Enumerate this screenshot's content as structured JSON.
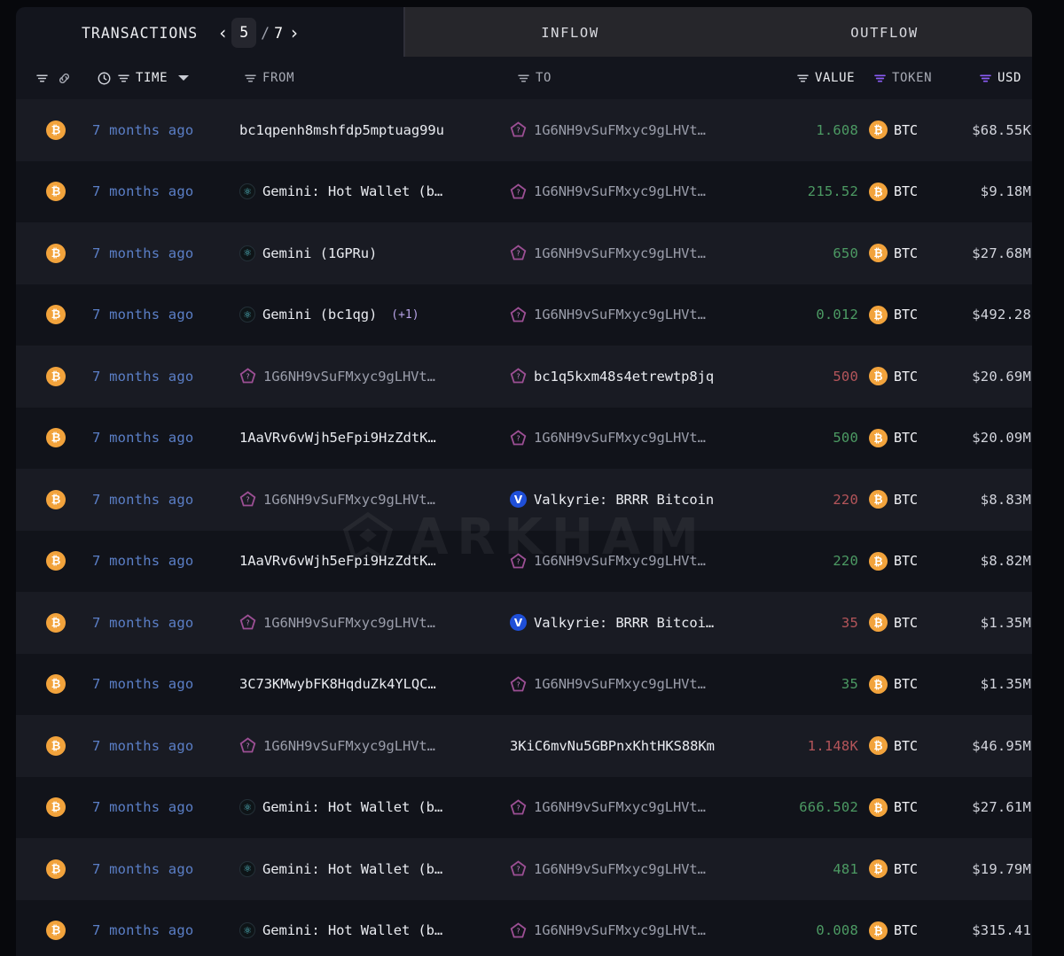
{
  "header": {
    "title": "TRANSACTIONS",
    "pager": {
      "prev": "‹",
      "current": "5",
      "separator": "/",
      "total": "7",
      "next": "›"
    },
    "tabs": [
      {
        "label": "INFLOW",
        "name": "tab-inflow"
      },
      {
        "label": "OUTFLOW",
        "name": "tab-outflow"
      }
    ]
  },
  "columns": {
    "chain": {
      "label": "",
      "icon": "chain-link-icon"
    },
    "time": {
      "label": "TIME",
      "icon": "clock-icon",
      "sorted": true
    },
    "from": {
      "label": "FROM"
    },
    "to": {
      "label": "TO"
    },
    "value": {
      "label": "VALUE"
    },
    "token": {
      "label": "TOKEN",
      "filter_active": true
    },
    "usd": {
      "label": "USD",
      "filter_active": true
    }
  },
  "watermark": {
    "text": "ARKHAM"
  },
  "colors": {
    "positive": "#4c9a63",
    "negative": "#b4555a",
    "time": "#5b7fc7",
    "accent_purple": "#8b5cf6",
    "btc_orange": "#f2a33c",
    "panel_bg": "#13151d",
    "row_bg": "#11131a",
    "row_alt_bg": "#191b23",
    "tab_bg": "#26262b"
  },
  "rows": [
    {
      "chain": "BTC",
      "time": "7 months ago",
      "from": {
        "text": "bc1qpenh8mshfdp5mptuag99u",
        "icon": "none",
        "style": "plain"
      },
      "to": {
        "text": "1G6NH9vSuFMxyc9gLHVt…",
        "icon": "unknown-entity-icon",
        "style": "muted"
      },
      "value": "1.608",
      "direction": "in",
      "token": "BTC",
      "usd": "$68.55K"
    },
    {
      "chain": "BTC",
      "time": "7 months ago",
      "from": {
        "text": "Gemini: Hot Wallet (b…",
        "icon": "gemini-icon",
        "style": "plain"
      },
      "to": {
        "text": "1G6NH9vSuFMxyc9gLHVt…",
        "icon": "unknown-entity-icon",
        "style": "muted"
      },
      "value": "215.52",
      "direction": "in",
      "token": "BTC",
      "usd": "$9.18M"
    },
    {
      "chain": "BTC",
      "time": "7 months ago",
      "from": {
        "text": "Gemini (1GPRu)",
        "icon": "gemini-icon",
        "style": "plain"
      },
      "to": {
        "text": "1G6NH9vSuFMxyc9gLHVt…",
        "icon": "unknown-entity-icon",
        "style": "muted"
      },
      "value": "650",
      "direction": "in",
      "token": "BTC",
      "usd": "$27.68M"
    },
    {
      "chain": "BTC",
      "time": "7 months ago",
      "from": {
        "text": "Gemini (bc1qg)",
        "icon": "gemini-icon",
        "style": "plain",
        "extra": "(+1)"
      },
      "to": {
        "text": "1G6NH9vSuFMxyc9gLHVt…",
        "icon": "unknown-entity-icon",
        "style": "muted"
      },
      "value": "0.012",
      "direction": "in",
      "token": "BTC",
      "usd": "$492.28"
    },
    {
      "chain": "BTC",
      "time": "7 months ago",
      "from": {
        "text": "1G6NH9vSuFMxyc9gLHVt…",
        "icon": "unknown-entity-icon",
        "style": "muted"
      },
      "to": {
        "text": "bc1q5kxm48s4etrewtp8jq",
        "icon": "unknown-entity-icon",
        "style": "plain"
      },
      "value": "500",
      "direction": "out",
      "token": "BTC",
      "usd": "$20.69M"
    },
    {
      "chain": "BTC",
      "time": "7 months ago",
      "from": {
        "text": "1AaVRv6vWjh5eFpi9HzZdtK…",
        "icon": "none",
        "style": "plain"
      },
      "to": {
        "text": "1G6NH9vSuFMxyc9gLHVt…",
        "icon": "unknown-entity-icon",
        "style": "muted"
      },
      "value": "500",
      "direction": "in",
      "token": "BTC",
      "usd": "$20.09M"
    },
    {
      "chain": "BTC",
      "time": "7 months ago",
      "from": {
        "text": "1G6NH9vSuFMxyc9gLHVt…",
        "icon": "unknown-entity-icon",
        "style": "muted"
      },
      "to": {
        "text": "Valkyrie: BRRR Bitcoin",
        "icon": "valkyrie-icon",
        "style": "plain"
      },
      "value": "220",
      "direction": "out",
      "token": "BTC",
      "usd": "$8.83M"
    },
    {
      "chain": "BTC",
      "time": "7 months ago",
      "from": {
        "text": "1AaVRv6vWjh5eFpi9HzZdtK…",
        "icon": "none",
        "style": "plain"
      },
      "to": {
        "text": "1G6NH9vSuFMxyc9gLHVt…",
        "icon": "unknown-entity-icon",
        "style": "muted"
      },
      "value": "220",
      "direction": "in",
      "token": "BTC",
      "usd": "$8.82M"
    },
    {
      "chain": "BTC",
      "time": "7 months ago",
      "from": {
        "text": "1G6NH9vSuFMxyc9gLHVt…",
        "icon": "unknown-entity-icon",
        "style": "muted"
      },
      "to": {
        "text": "Valkyrie: BRRR Bitcoi…",
        "icon": "valkyrie-icon",
        "style": "plain"
      },
      "value": "35",
      "direction": "out",
      "token": "BTC",
      "usd": "$1.35M"
    },
    {
      "chain": "BTC",
      "time": "7 months ago",
      "from": {
        "text": "3C73KMwybFK8HqduZk4YLQC…",
        "icon": "none",
        "style": "plain"
      },
      "to": {
        "text": "1G6NH9vSuFMxyc9gLHVt…",
        "icon": "unknown-entity-icon",
        "style": "muted"
      },
      "value": "35",
      "direction": "in",
      "token": "BTC",
      "usd": "$1.35M"
    },
    {
      "chain": "BTC",
      "time": "7 months ago",
      "from": {
        "text": "1G6NH9vSuFMxyc9gLHVt…",
        "icon": "unknown-entity-icon",
        "style": "muted"
      },
      "to": {
        "text": "3KiC6mvNu5GBPnxKhtHKS88Km",
        "icon": "none",
        "style": "plain"
      },
      "value": "1.148K",
      "direction": "out",
      "token": "BTC",
      "usd": "$46.95M"
    },
    {
      "chain": "BTC",
      "time": "7 months ago",
      "from": {
        "text": "Gemini: Hot Wallet (b…",
        "icon": "gemini-icon",
        "style": "plain"
      },
      "to": {
        "text": "1G6NH9vSuFMxyc9gLHVt…",
        "icon": "unknown-entity-icon",
        "style": "muted"
      },
      "value": "666.502",
      "direction": "in",
      "token": "BTC",
      "usd": "$27.61M"
    },
    {
      "chain": "BTC",
      "time": "7 months ago",
      "from": {
        "text": "Gemini: Hot Wallet (b…",
        "icon": "gemini-icon",
        "style": "plain"
      },
      "to": {
        "text": "1G6NH9vSuFMxyc9gLHVt…",
        "icon": "unknown-entity-icon",
        "style": "muted"
      },
      "value": "481",
      "direction": "in",
      "token": "BTC",
      "usd": "$19.79M"
    },
    {
      "chain": "BTC",
      "time": "7 months ago",
      "from": {
        "text": "Gemini: Hot Wallet (b…",
        "icon": "gemini-icon",
        "style": "plain"
      },
      "to": {
        "text": "1G6NH9vSuFMxyc9gLHVt…",
        "icon": "unknown-entity-icon",
        "style": "muted"
      },
      "value": "0.008",
      "direction": "in",
      "token": "BTC",
      "usd": "$315.41"
    }
  ]
}
